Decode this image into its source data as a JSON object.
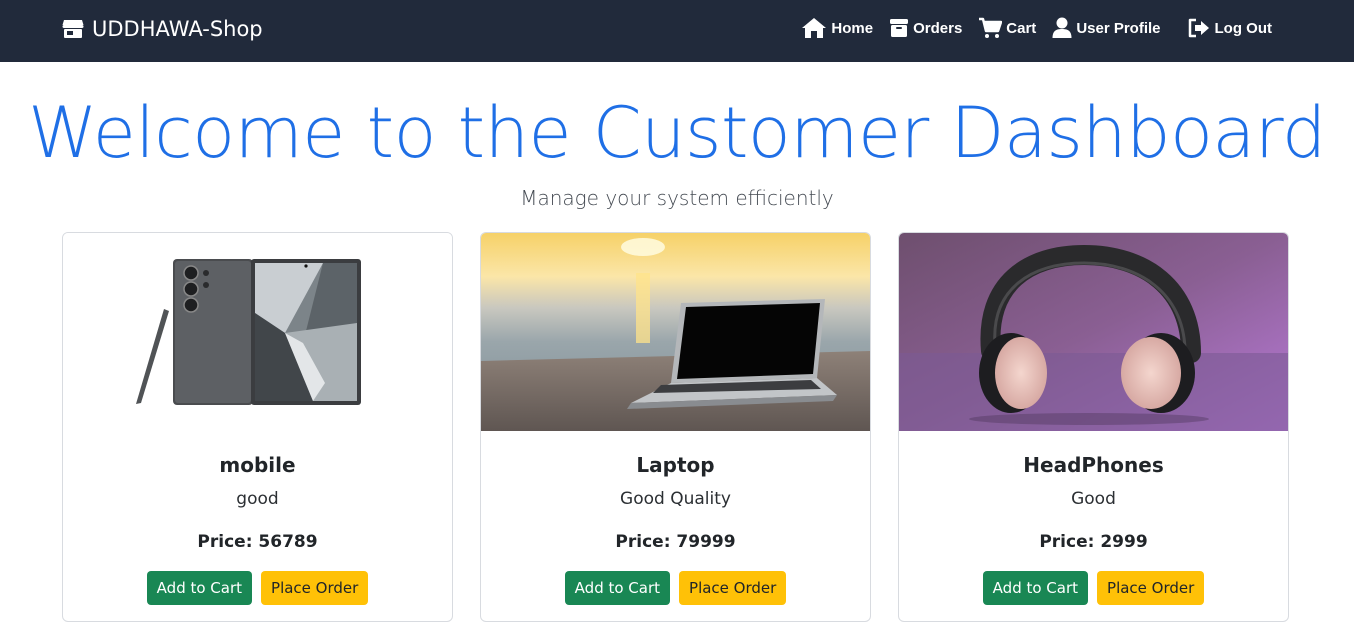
{
  "brand": {
    "name": "UDDHAWA-Shop",
    "icon": "store-icon"
  },
  "nav": {
    "home": "Home",
    "orders": "Orders",
    "cart": "Cart",
    "profile": "User Profile",
    "logout": "Log Out"
  },
  "hero": {
    "title": "Welcome to the Customer Dashboard",
    "subtitle": "Manage your system efficiently"
  },
  "products": [
    {
      "name": "mobile",
      "description": "good",
      "price": "Price: 56789",
      "add_label": "Add to Cart",
      "order_label": "Place Order",
      "image": "smartphone-with-stylus"
    },
    {
      "name": "Laptop",
      "description": "Good Quality",
      "price": "Price: 79999",
      "add_label": "Add to Cart",
      "order_label": "Place Order",
      "image": "laptop-on-beach-at-sunset"
    },
    {
      "name": "HeadPhones",
      "description": "Good",
      "price": "Price: 2999",
      "add_label": "Add to Cart",
      "order_label": "Place Order",
      "image": "headphones-purple-background"
    }
  ],
  "colors": {
    "navbar": "#212a3b",
    "title": "#1f6fe6",
    "success": "#198754",
    "warning": "#ffc107"
  }
}
